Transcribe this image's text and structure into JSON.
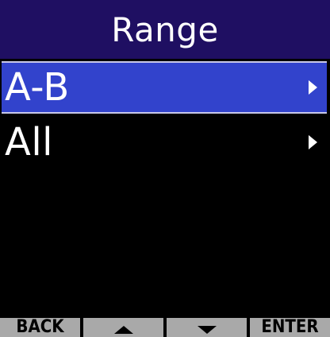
{
  "title": "Range",
  "menu": {
    "items": [
      {
        "label": "A-B",
        "selected": true,
        "icon": "chevron-right-icon"
      },
      {
        "label": "All",
        "selected": false,
        "icon": "chevron-right-icon"
      }
    ]
  },
  "softkeys": {
    "back": "BACK",
    "up_icon": "triangle-up-icon",
    "down_icon": "triangle-down-icon",
    "enter": "ENTER"
  },
  "colors": {
    "title_bar": "#1f0f62",
    "selection": "#3243cc",
    "softkey_bg": "#a9a9a9",
    "background": "#000000"
  }
}
